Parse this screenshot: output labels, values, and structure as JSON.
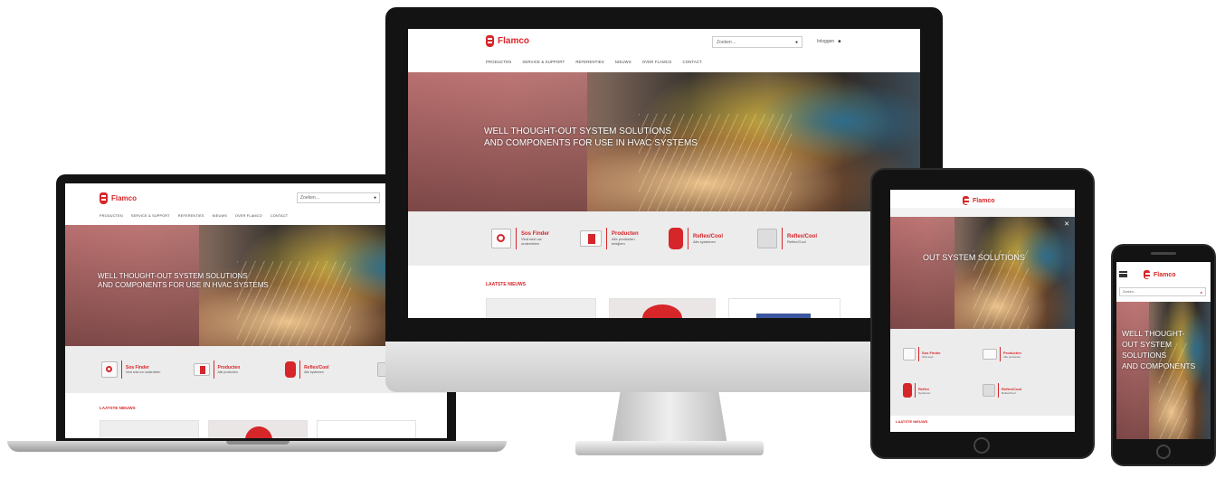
{
  "brand": {
    "name": "Flamco",
    "accent": "#d6262a"
  },
  "monitor": {
    "search_placeholder": "Zoeken…",
    "login": "Inloggen",
    "nav": [
      "PRODUCTEN",
      "SERVICE & SUPPORT",
      "REFERENTIES",
      "NIEUWS",
      "OVER FLAMCO",
      "CONTACT"
    ],
    "hero_line1": "WELL THOUGHT-OUT SYSTEM SOLUTIONS",
    "hero_line2": "AND COMPONENTS FOR USE IN HVAC SYSTEMS",
    "features": [
      {
        "title": "Sos Finder",
        "sub": "Vind snel uw onderdelen",
        "icon": "magnifier-icon"
      },
      {
        "title": "Producten",
        "sub": "Alle producten bekijken",
        "icon": "document-icon"
      },
      {
        "title": "Reflex/Cool",
        "sub": "Alle systemen",
        "icon": "vessel-icon"
      },
      {
        "title": "Reflex/Cool",
        "sub": "Reflex/Cool",
        "icon": "building-icon"
      }
    ],
    "cards_heading": "LAATSTE NIEUWS"
  },
  "laptop": {
    "search_placeholder": "Zoeken…",
    "nav": [
      "PRODUCTEN",
      "SERVICE & SUPPORT",
      "REFERENTIES",
      "NIEUWS",
      "OVER FLAMCO",
      "CONTACT"
    ],
    "hero_line1": "WELL THOUGHT-OUT SYSTEM SOLUTIONS",
    "hero_line2": "AND COMPONENTS FOR USE IN HVAC SYSTEMS",
    "features": [
      {
        "title": "Sos Finder",
        "sub": "Vind snel uw onderdelen"
      },
      {
        "title": "Producten",
        "sub": "Alle producten"
      },
      {
        "title": "Reflex/Cool",
        "sub": "Alle systemen"
      }
    ],
    "cards_heading": "LAATSTE NIEUWS"
  },
  "tablet": {
    "hero_line": "OUT SYSTEM SOLUTIONS",
    "features": [
      {
        "title": "Sos Finder",
        "sub": "Vind snel"
      },
      {
        "title": "Producten",
        "sub": "Alle producten"
      },
      {
        "title": "Reflex",
        "sub": "Systemen"
      },
      {
        "title": "Reflex/Cool",
        "sub": "Reflex/Cool"
      }
    ],
    "cards_heading": "LAATSTE NIEUWS"
  },
  "phone": {
    "search_placeholder": "Zoeken…",
    "hero_lines": [
      "WELL THOUGHT-",
      "OUT SYSTEM",
      "SOLUTIONS",
      "AND COMPONENTS"
    ]
  }
}
